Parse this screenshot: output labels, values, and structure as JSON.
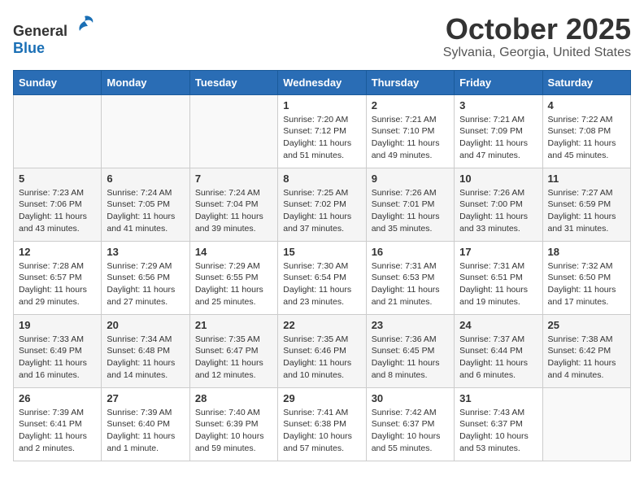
{
  "header": {
    "logo_general": "General",
    "logo_blue": "Blue",
    "month": "October 2025",
    "location": "Sylvania, Georgia, United States"
  },
  "days_of_week": [
    "Sunday",
    "Monday",
    "Tuesday",
    "Wednesday",
    "Thursday",
    "Friday",
    "Saturday"
  ],
  "weeks": [
    [
      {
        "day": "",
        "info": ""
      },
      {
        "day": "",
        "info": ""
      },
      {
        "day": "",
        "info": ""
      },
      {
        "day": "1",
        "info": "Sunrise: 7:20 AM\nSunset: 7:12 PM\nDaylight: 11 hours\nand 51 minutes."
      },
      {
        "day": "2",
        "info": "Sunrise: 7:21 AM\nSunset: 7:10 PM\nDaylight: 11 hours\nand 49 minutes."
      },
      {
        "day": "3",
        "info": "Sunrise: 7:21 AM\nSunset: 7:09 PM\nDaylight: 11 hours\nand 47 minutes."
      },
      {
        "day": "4",
        "info": "Sunrise: 7:22 AM\nSunset: 7:08 PM\nDaylight: 11 hours\nand 45 minutes."
      }
    ],
    [
      {
        "day": "5",
        "info": "Sunrise: 7:23 AM\nSunset: 7:06 PM\nDaylight: 11 hours\nand 43 minutes."
      },
      {
        "day": "6",
        "info": "Sunrise: 7:24 AM\nSunset: 7:05 PM\nDaylight: 11 hours\nand 41 minutes."
      },
      {
        "day": "7",
        "info": "Sunrise: 7:24 AM\nSunset: 7:04 PM\nDaylight: 11 hours\nand 39 minutes."
      },
      {
        "day": "8",
        "info": "Sunrise: 7:25 AM\nSunset: 7:02 PM\nDaylight: 11 hours\nand 37 minutes."
      },
      {
        "day": "9",
        "info": "Sunrise: 7:26 AM\nSunset: 7:01 PM\nDaylight: 11 hours\nand 35 minutes."
      },
      {
        "day": "10",
        "info": "Sunrise: 7:26 AM\nSunset: 7:00 PM\nDaylight: 11 hours\nand 33 minutes."
      },
      {
        "day": "11",
        "info": "Sunrise: 7:27 AM\nSunset: 6:59 PM\nDaylight: 11 hours\nand 31 minutes."
      }
    ],
    [
      {
        "day": "12",
        "info": "Sunrise: 7:28 AM\nSunset: 6:57 PM\nDaylight: 11 hours\nand 29 minutes."
      },
      {
        "day": "13",
        "info": "Sunrise: 7:29 AM\nSunset: 6:56 PM\nDaylight: 11 hours\nand 27 minutes."
      },
      {
        "day": "14",
        "info": "Sunrise: 7:29 AM\nSunset: 6:55 PM\nDaylight: 11 hours\nand 25 minutes."
      },
      {
        "day": "15",
        "info": "Sunrise: 7:30 AM\nSunset: 6:54 PM\nDaylight: 11 hours\nand 23 minutes."
      },
      {
        "day": "16",
        "info": "Sunrise: 7:31 AM\nSunset: 6:53 PM\nDaylight: 11 hours\nand 21 minutes."
      },
      {
        "day": "17",
        "info": "Sunrise: 7:31 AM\nSunset: 6:51 PM\nDaylight: 11 hours\nand 19 minutes."
      },
      {
        "day": "18",
        "info": "Sunrise: 7:32 AM\nSunset: 6:50 PM\nDaylight: 11 hours\nand 17 minutes."
      }
    ],
    [
      {
        "day": "19",
        "info": "Sunrise: 7:33 AM\nSunset: 6:49 PM\nDaylight: 11 hours\nand 16 minutes."
      },
      {
        "day": "20",
        "info": "Sunrise: 7:34 AM\nSunset: 6:48 PM\nDaylight: 11 hours\nand 14 minutes."
      },
      {
        "day": "21",
        "info": "Sunrise: 7:35 AM\nSunset: 6:47 PM\nDaylight: 11 hours\nand 12 minutes."
      },
      {
        "day": "22",
        "info": "Sunrise: 7:35 AM\nSunset: 6:46 PM\nDaylight: 11 hours\nand 10 minutes."
      },
      {
        "day": "23",
        "info": "Sunrise: 7:36 AM\nSunset: 6:45 PM\nDaylight: 11 hours\nand 8 minutes."
      },
      {
        "day": "24",
        "info": "Sunrise: 7:37 AM\nSunset: 6:44 PM\nDaylight: 11 hours\nand 6 minutes."
      },
      {
        "day": "25",
        "info": "Sunrise: 7:38 AM\nSunset: 6:42 PM\nDaylight: 11 hours\nand 4 minutes."
      }
    ],
    [
      {
        "day": "26",
        "info": "Sunrise: 7:39 AM\nSunset: 6:41 PM\nDaylight: 11 hours\nand 2 minutes."
      },
      {
        "day": "27",
        "info": "Sunrise: 7:39 AM\nSunset: 6:40 PM\nDaylight: 11 hours\nand 1 minute."
      },
      {
        "day": "28",
        "info": "Sunrise: 7:40 AM\nSunset: 6:39 PM\nDaylight: 10 hours\nand 59 minutes."
      },
      {
        "day": "29",
        "info": "Sunrise: 7:41 AM\nSunset: 6:38 PM\nDaylight: 10 hours\nand 57 minutes."
      },
      {
        "day": "30",
        "info": "Sunrise: 7:42 AM\nSunset: 6:37 PM\nDaylight: 10 hours\nand 55 minutes."
      },
      {
        "day": "31",
        "info": "Sunrise: 7:43 AM\nSunset: 6:37 PM\nDaylight: 10 hours\nand 53 minutes."
      },
      {
        "day": "",
        "info": ""
      }
    ]
  ]
}
